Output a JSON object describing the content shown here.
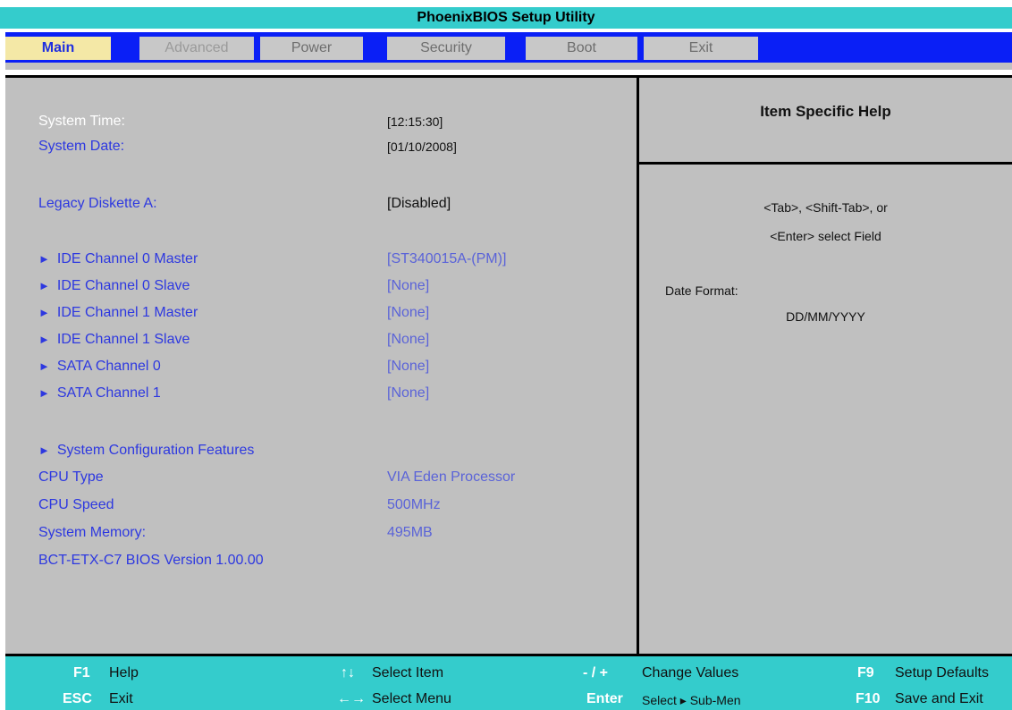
{
  "title": "PhoenixBIOS Setup Utility",
  "menu": {
    "tabs": [
      {
        "label": "Main"
      },
      {
        "label": "Advanced"
      },
      {
        "label": "Power"
      },
      {
        "label": "Security"
      },
      {
        "label": "Boot"
      },
      {
        "label": "Exit"
      }
    ]
  },
  "main": {
    "system_time": {
      "label": "System Time:",
      "value": "[12:15:30]"
    },
    "system_date": {
      "label": "System Date:",
      "value": "[01/10/2008]"
    },
    "legacy_diskette": {
      "label": "Legacy Diskette A:",
      "value": "[Disabled]"
    },
    "submenus": [
      {
        "label": "IDE Channel 0 Master",
        "value": "[ST340015A-(PM)]"
      },
      {
        "label": "IDE Channel 0 Slave",
        "value": "[None]"
      },
      {
        "label": "IDE Channel 1 Master",
        "value": "[None]"
      },
      {
        "label": "IDE Channel 1 Slave",
        "value": "[None]"
      },
      {
        "label": "SATA Channel 0",
        "value": "[None]"
      },
      {
        "label": "SATA Channel 1",
        "value": "[None]"
      }
    ],
    "system_config": {
      "label": "System Configuration Features"
    },
    "cpu_type": {
      "label": "CPU Type",
      "value": "VIA Eden Processor"
    },
    "cpu_speed": {
      "label": "CPU Speed",
      "value": "500MHz"
    },
    "system_memory": {
      "label": "System Memory:",
      "value": "495MB"
    },
    "bios_version": "BCT-ETX-C7 BIOS Version 1.00.00",
    "arrow_glyph": "►"
  },
  "help": {
    "title": "Item Specific Help",
    "line1": "<Tab>, <Shift-Tab>, or",
    "line2": "<Enter> select Field",
    "date_format_label": "Date Format:",
    "date_format_value": "DD/MM/YYYY"
  },
  "footer": {
    "f1": {
      "key": "F1",
      "desc": "Help"
    },
    "esc": {
      "key": "ESC",
      "desc": "Exit"
    },
    "updown": {
      "key": "↑↓",
      "desc": "Select Item"
    },
    "leftright": {
      "key": "←→",
      "desc": "Select Menu"
    },
    "plusminus": {
      "key": "- / +",
      "desc": "Change Values"
    },
    "enter": {
      "key": "Enter",
      "desc": "Select ▸ Sub-Men"
    },
    "f9": {
      "key": "F9",
      "desc": "Setup Defaults"
    },
    "f10": {
      "key": "F10",
      "desc": "Save and Exit"
    }
  },
  "colors": {
    "title_bar": "#34cccc",
    "menu_bar": "#0a1ff6",
    "panel": "#c0c0c0",
    "active_tab": "#f4e8a6",
    "label_blue": "#2d38e0"
  }
}
